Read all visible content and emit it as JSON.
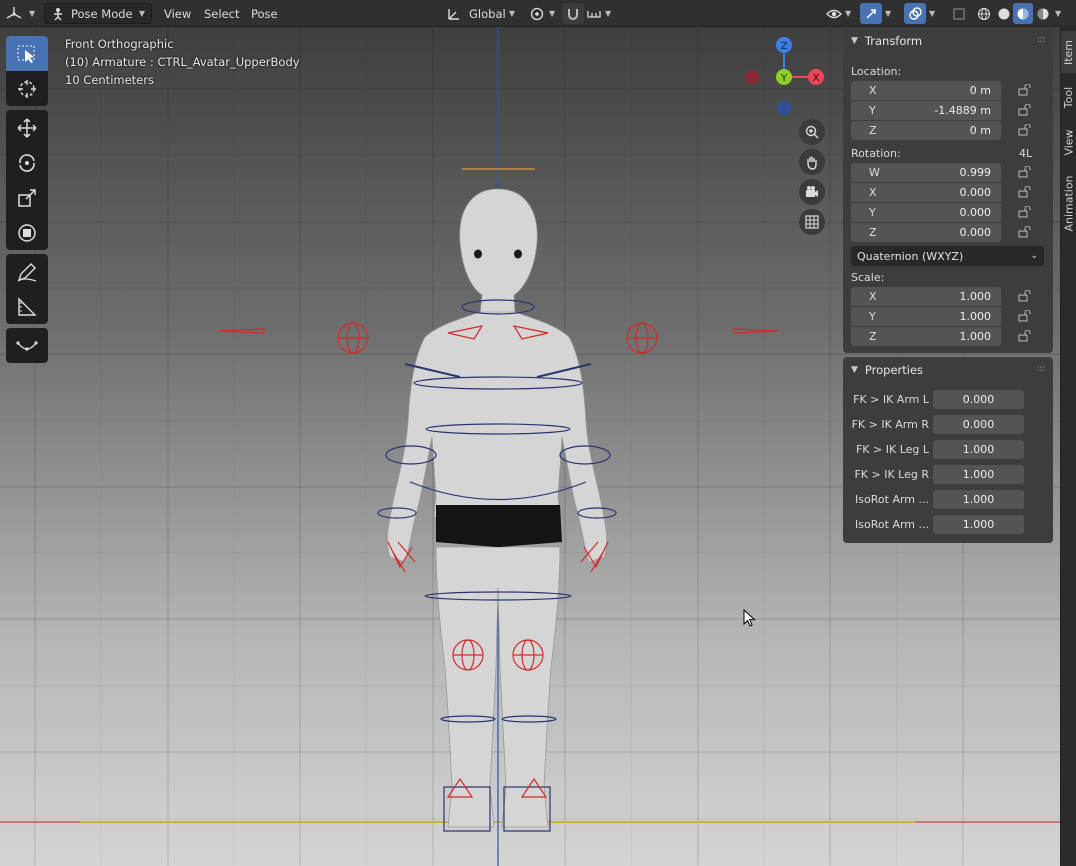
{
  "header": {
    "mode_label": "Pose Mode",
    "menus": [
      "View",
      "Select",
      "Pose"
    ],
    "transform_orientation": "Global"
  },
  "viewport": {
    "view_name": "Front Orthographic",
    "object_info": "(10) Armature : CTRL_Avatar_UpperBody",
    "grid_scale": "10 Centimeters",
    "gizmo_axes": {
      "z": "Z",
      "y": "Y",
      "x": "X"
    }
  },
  "side_tabs": [
    "Item",
    "Tool",
    "View",
    "Animation"
  ],
  "transform_panel": {
    "title": "Transform",
    "location_label": "Location:",
    "location": [
      {
        "axis": "X",
        "value": "0 m"
      },
      {
        "axis": "Y",
        "value": "-1.4889 m"
      },
      {
        "axis": "Z",
        "value": "0 m"
      }
    ],
    "rotation_label": "Rotation:",
    "rotation_mode_short": "4L",
    "rotation": [
      {
        "axis": "W",
        "value": "0.999"
      },
      {
        "axis": "X",
        "value": "0.000"
      },
      {
        "axis": "Y",
        "value": "0.000"
      },
      {
        "axis": "Z",
        "value": "0.000"
      }
    ],
    "rotation_mode": "Quaternion (WXYZ)",
    "scale_label": "Scale:",
    "scale": [
      {
        "axis": "X",
        "value": "1.000"
      },
      {
        "axis": "Y",
        "value": "1.000"
      },
      {
        "axis": "Z",
        "value": "1.000"
      }
    ]
  },
  "properties_panel": {
    "title": "Properties",
    "rows": [
      {
        "label": "FK > IK Arm L",
        "value": "0.000"
      },
      {
        "label": "FK > IK Arm R",
        "value": "0.000"
      },
      {
        "label": "FK > IK Leg L",
        "value": "1.000"
      },
      {
        "label": "FK > IK Leg R",
        "value": "1.000"
      },
      {
        "label": "IsoRot Arm ...",
        "value": "1.000"
      },
      {
        "label": "IsoRot Arm ...",
        "value": "1.000"
      }
    ]
  },
  "colors": {
    "accent": "#4772b3",
    "bone_blue": "#2a3572",
    "bone_red": "#d42a2a",
    "axis_x": "#f0465a",
    "axis_y": "#8fcf2a",
    "axis_z": "#3a7ee8"
  }
}
